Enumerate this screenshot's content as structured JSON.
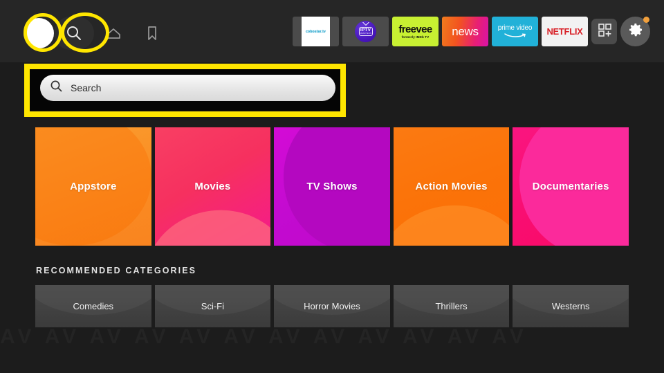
{
  "topbar": {
    "avatar": {
      "name": "profile-avatar"
    },
    "nav": [
      {
        "icon": "search-icon",
        "label": "Search"
      },
      {
        "icon": "home-icon",
        "label": "Home"
      },
      {
        "icon": "bookmark-icon",
        "label": "Bookmarks"
      }
    ],
    "apps": [
      {
        "name": "cobostar-tv",
        "label": "cobostar.tv"
      },
      {
        "name": "iptv-smarters",
        "label": "IPTV",
        "sublabel": "SMARTERS"
      },
      {
        "name": "freevee",
        "label": "freevee",
        "sublabel": "formerly IMDb TV"
      },
      {
        "name": "news",
        "label": "news"
      },
      {
        "name": "prime-video",
        "label": "prime video"
      },
      {
        "name": "netflix",
        "label": "NETFLIX"
      }
    ],
    "apps_grid_button": {
      "name": "apps-grid-icon",
      "label": "Apps"
    },
    "settings_button": {
      "name": "gear-icon",
      "label": "Settings",
      "has_notification": true
    }
  },
  "search": {
    "placeholder": "Search",
    "value": "",
    "icon": "search-icon"
  },
  "categories": [
    {
      "label": "Appstore"
    },
    {
      "label": "Movies"
    },
    {
      "label": "TV Shows"
    },
    {
      "label": "Action Movies"
    },
    {
      "label": "Documentaries"
    }
  ],
  "recommended": {
    "title": "RECOMMENDED CATEGORIES",
    "items": [
      {
        "label": "Comedies"
      },
      {
        "label": "Sci-Fi"
      },
      {
        "label": "Horror Movies"
      },
      {
        "label": "Thrillers"
      },
      {
        "label": "Westerns"
      }
    ]
  },
  "annotations": {
    "highlight_color": "#ffe600",
    "shapes": [
      {
        "name": "avatar-highlight-circle",
        "shape": "circle"
      },
      {
        "name": "search-icon-highlight-ellipse",
        "shape": "ellipse"
      },
      {
        "name": "search-bar-highlight-rect",
        "shape": "rectangle"
      }
    ]
  },
  "watermark": {
    "text": "AV AV AV AV AV AV AV AV AV AV AV AV"
  }
}
